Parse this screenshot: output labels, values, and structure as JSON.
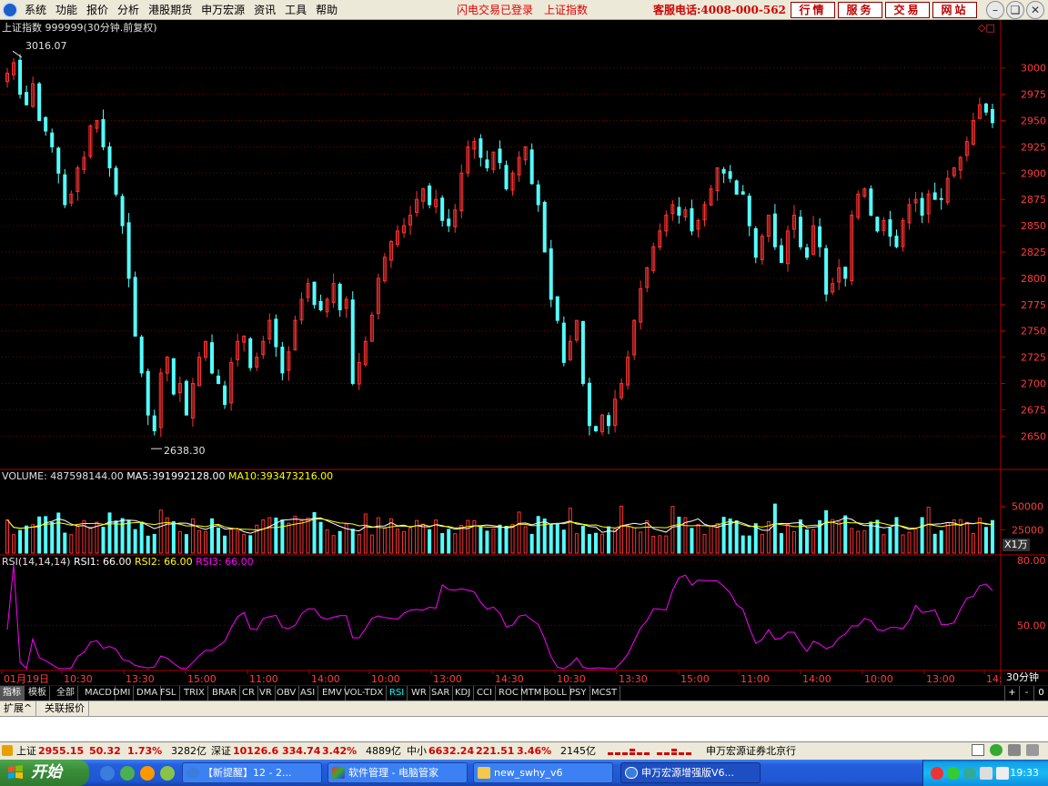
{
  "menu": {
    "items": [
      "系统",
      "功能",
      "报价",
      "分析",
      "港股期货",
      "申万宏源",
      "资讯",
      "工具",
      "帮助"
    ],
    "login_status": "闪电交易已登录",
    "current_index": "上证指数",
    "hotline": "客服电话:4008-000-562",
    "quick_buttons": [
      "行情",
      "服务",
      "交易",
      "网站"
    ]
  },
  "chart": {
    "title": "上证指数 999999(30分钟.前复权)",
    "high_label": "3016.07",
    "low_label": "2638.30",
    "volume_header": {
      "label": "VOLUME:",
      "value": "487598144.00",
      "ma5_label": "MA5:",
      "ma5_value": "391992128.00",
      "ma10_label": "MA10:",
      "ma10_value": "393473216.00"
    },
    "volume_unit": "X1万",
    "rsi_header": {
      "label": "RSI(14,14,14)",
      "rsi1": "RSI1: 66.00",
      "rsi2": "RSI2: 66.00",
      "rsi3": "RSI3: 66.00"
    },
    "period_label": "30分钟",
    "colors": {
      "up": "#ff3232",
      "down": "#54ffff",
      "ma5": "#ffffff",
      "ma10": "#ffff00",
      "rsi": "#ff00ff",
      "axis": "#b00000"
    }
  },
  "chart_data": {
    "type": "candlestick",
    "ylim": [
      2620,
      3030
    ],
    "y_ticks": [
      "3000",
      "2975",
      "2950",
      "2925",
      "2900",
      "2875",
      "2850",
      "2825",
      "2800",
      "2775",
      "2750",
      "2725",
      "2700",
      "2675",
      "2650"
    ],
    "x_labels": [
      "01月19日",
      "10:30",
      "13:30",
      "15:00",
      "11:00",
      "14:00",
      "10:00",
      "13:00",
      "14:30",
      "10:30",
      "13:30",
      "15:00",
      "11:00",
      "14:00",
      "10:00",
      "13:00",
      "14:"
    ],
    "close_path": [
      2995,
      3005,
      2975,
      2965,
      2985,
      2950,
      2940,
      2925,
      2900,
      2870,
      2880,
      2905,
      2915,
      2945,
      2950,
      2925,
      2905,
      2880,
      2850,
      2800,
      2745,
      2710,
      2670,
      2655,
      2710,
      2725,
      2690,
      2700,
      2670,
      2700,
      2725,
      2740,
      2710,
      2700,
      2680,
      2720,
      2740,
      2745,
      2715,
      2725,
      2740,
      2760,
      2735,
      2710,
      2730,
      2760,
      2780,
      2795,
      2775,
      2770,
      2780,
      2795,
      2770,
      2780,
      2700,
      2720,
      2740,
      2765,
      2800,
      2820,
      2835,
      2845,
      2850,
      2860,
      2875,
      2885,
      2870,
      2875,
      2855,
      2850,
      2865,
      2900,
      2925,
      2930,
      2915,
      2905,
      2920,
      2910,
      2885,
      2900,
      2915,
      2925,
      2890,
      2870,
      2825,
      2780,
      2760,
      2720,
      2740,
      2760,
      2700,
      2660,
      2655,
      2670,
      2660,
      2685,
      2700,
      2725,
      2760,
      2790,
      2810,
      2830,
      2845,
      2860,
      2870,
      2860,
      2865,
      2845,
      2855,
      2870,
      2885,
      2905,
      2900,
      2895,
      2880,
      2880,
      2850,
      2820,
      2840,
      2860,
      2830,
      2815,
      2845,
      2860,
      2830,
      2820,
      2850,
      2830,
      2785,
      2795,
      2810,
      2800,
      2860,
      2880,
      2885,
      2860,
      2845,
      2855,
      2840,
      2830,
      2855,
      2870,
      2875,
      2860,
      2880,
      2875,
      2875,
      2895,
      2905,
      2915,
      2930,
      2950,
      2965,
      2958,
      2948
    ],
    "rsi_ylim": [
      30,
      80
    ],
    "rsi_ticks": [
      "80.00",
      "50.00"
    ],
    "volume_ticks": [
      "50000",
      "25000"
    ],
    "last_rsi": 66.0
  },
  "indicator_tabs": [
    "指标",
    "模板",
    "全部",
    "MACD",
    "DMI",
    "DMA",
    "FSL",
    "TRIX",
    "BRAR",
    "CR",
    "VR",
    "OBV",
    "ASI",
    "EMV",
    "VOL-TDX",
    "RSI",
    "WR",
    "SAR",
    "KDJ",
    "CCI",
    "ROC",
    "MTM",
    "BOLL",
    "PSY",
    "MCST"
  ],
  "zoom_buttons": [
    "+",
    "-",
    "0"
  ],
  "sub_tabs": [
    "扩展^",
    "关联报价"
  ],
  "status": {
    "sh_label": "上证",
    "sh_value": "2955.15",
    "sh_change": "50.32",
    "sh_pct": "1.73%",
    "sh_amount": "3282亿",
    "sz_label": "深证",
    "sz_value": "10126.6",
    "sz_change": "334.74",
    "sz_pct": "3.42%",
    "sz_amount": "4889亿",
    "zx_label": "中小",
    "zx_value": "6632.24",
    "zx_change": "221.51",
    "zx_pct": "3.46%",
    "zx_amount": "2145亿",
    "broker": "申万宏源证券北京行"
  },
  "taskbar": {
    "start": "开始",
    "tasks": [
      "【新提醒】12 - 2...",
      "软件管理 - 电脑管家",
      "new_swhy_v6",
      "申万宏源增强版V6..."
    ],
    "clock": "19:33"
  }
}
